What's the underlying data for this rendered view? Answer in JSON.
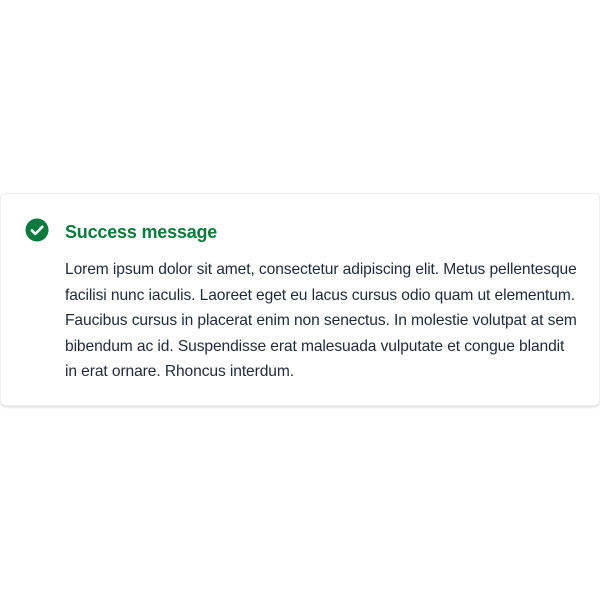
{
  "alert": {
    "type": "success",
    "icon": "check-circle-icon",
    "accent_color": "#0a7a3e",
    "title": "Success message",
    "body": "Lorem ipsum dolor sit amet, consectetur adipiscing elit. Metus pellentesque facilisi nunc iaculis. Laoreet eget eu lacus cursus odio quam ut elementum. Faucibus cursus in placerat enim non senectus. In molestie volutpat at sem bibendum ac id. Suspendisse erat malesuada vulputate et congue blandit in erat ornare. Rhoncus interdum."
  }
}
